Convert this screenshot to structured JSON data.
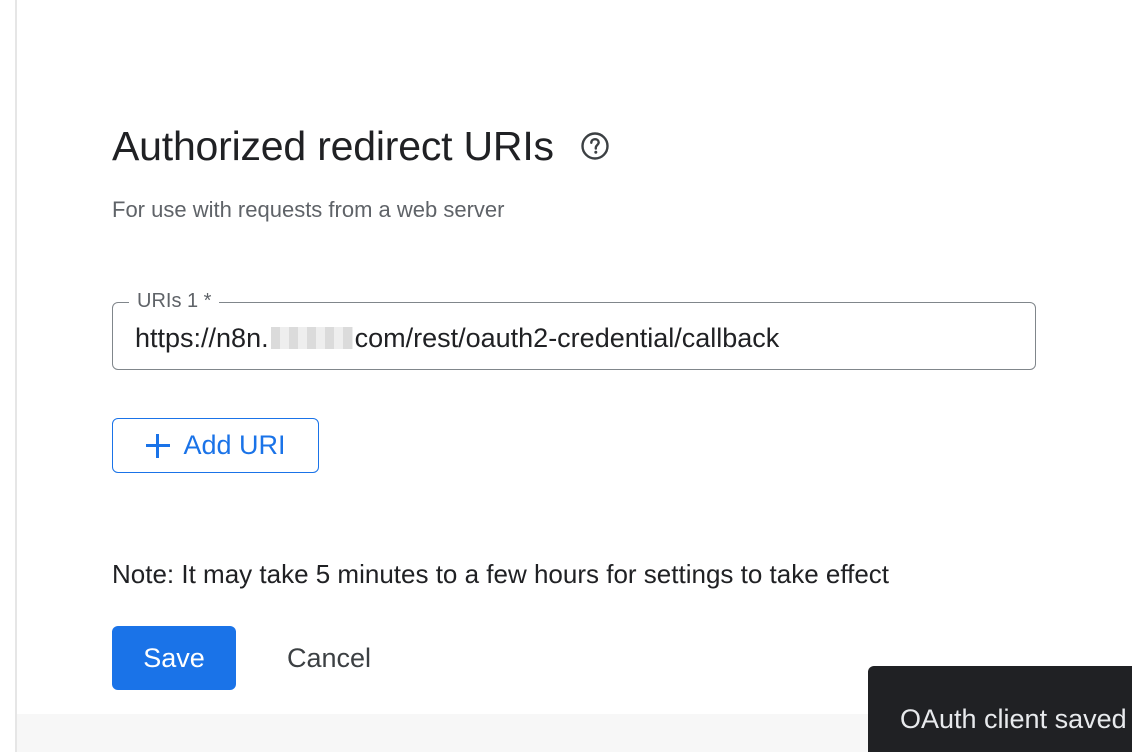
{
  "section": {
    "title": "Authorized redirect URIs",
    "help_icon": "help-circle-icon",
    "subtitle": "For use with requests from a web server"
  },
  "uri_field": {
    "label": "URIs 1 *",
    "value_prefix": "https://n8n.",
    "value_suffix": "com/rest/oauth2-credential/callback"
  },
  "add_uri": {
    "icon": "plus-icon",
    "label": "Add URI"
  },
  "note": "Note: It may take 5 minutes to a few hours for settings to take effect",
  "actions": {
    "save_label": "Save",
    "cancel_label": "Cancel"
  },
  "snackbar": {
    "text": "OAuth client saved"
  },
  "colors": {
    "accent": "#1a73e8",
    "text_primary": "#202124",
    "text_secondary": "#5f6368",
    "snackbar_bg": "#202124"
  }
}
